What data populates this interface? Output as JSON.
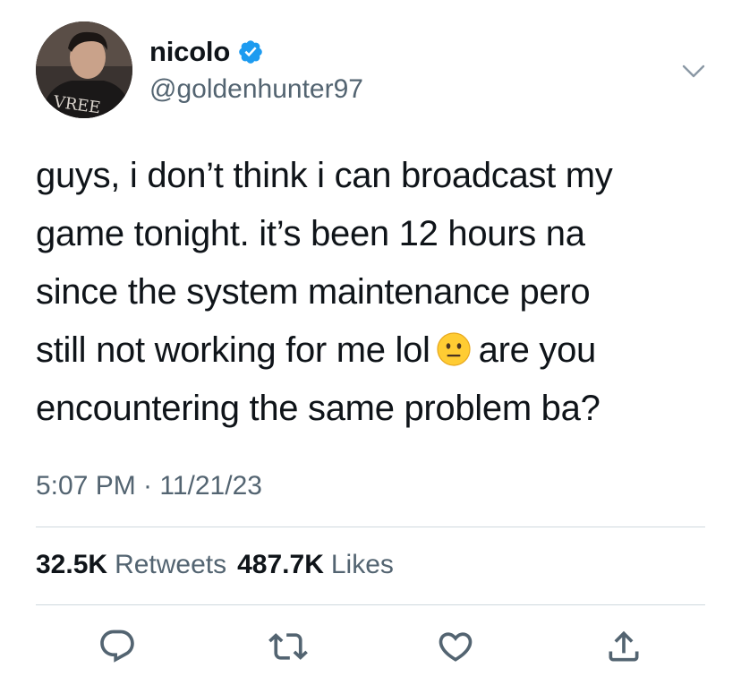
{
  "author": {
    "display_name": "nicolo",
    "handle": "@goldenhunter97",
    "verified": true,
    "avatar_icon": "profile-photo"
  },
  "tweet": {
    "lines": [
      "guys, i don’t think i can broadcast my",
      "game tonight. it’s been 12 hours na",
      "since the system maintenance pero",
      "still not working for me lol",
      "are you",
      "encountering the same problem ba?"
    ],
    "emoji": "neutral-face-emoji",
    "timestamp": "5:07 PM · 11/21/23"
  },
  "stats": {
    "retweets_count": "32.5K",
    "retweets_label": "Retweets",
    "likes_count": "487.7K",
    "likes_label": "Likes"
  },
  "actions": [
    {
      "name": "reply",
      "icon": "speech-bubble-icon"
    },
    {
      "name": "retweet",
      "icon": "retweet-arrows-icon"
    },
    {
      "name": "like",
      "icon": "heart-icon"
    },
    {
      "name": "share",
      "icon": "share-upload-icon"
    }
  ],
  "colors": {
    "text_primary": "#0f1419",
    "text_secondary": "#536471",
    "verified_blue": "#1d9bf0",
    "divider": "#cfd9de",
    "emoji_yellow": "#ffcc33"
  }
}
